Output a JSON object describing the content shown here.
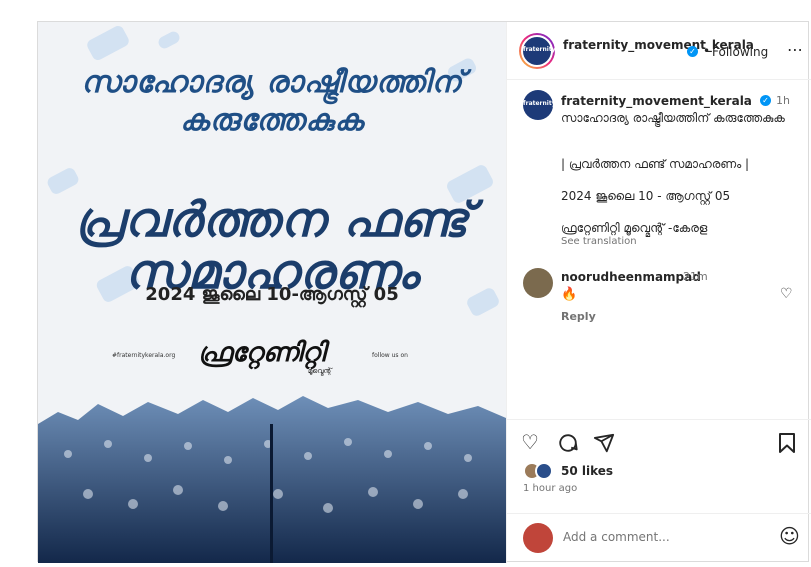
{
  "poster": {
    "headline": "സാഹോദര്യ രാഷ്ട്രീയത്തിന് കരുത്തേകുക",
    "campaign": "പ്രവർത്തന ഫണ്ട് സമാഹരണം",
    "date": "2024 ജൂലൈ 10-ആഗസ്റ്റ് 05",
    "site": "#fraternitykerala.org",
    "follow": "follow us on",
    "logo": "ഫ്രറ്റേണിറ്റി",
    "logo_sub": "മൂവ്മെന്റ്"
  },
  "header": {
    "username": "fraternity_movement_kerala",
    "follow_status": "Following",
    "avatar_text": "fraternity"
  },
  "caption": {
    "username": "fraternity_movement_kerala",
    "time": "1h",
    "line1": "സാഹോദര്യ രാഷ്ട്രീയത്തിന് കരുത്തേകുക",
    "line2": "| പ്രവർത്തന ഫണ്ട് സമാഹരണം |",
    "line3": "2024 ജൂലൈ 10 - ആഗസ്റ്റ് 05",
    "line4": "ഫ്രറ്റേണിറ്റി മൂവ്മെന്റ് -കേരള",
    "see_translation": "See translation"
  },
  "comment": {
    "username": "noorudheenmampad",
    "time": "21m",
    "text": "🔥",
    "reply": "Reply"
  },
  "engagement": {
    "likes": "50 likes",
    "posted": "1 hour ago"
  },
  "composer": {
    "placeholder": "Add a comment..."
  },
  "colors": {
    "accent": "#0095f6",
    "poster_blue": "#1f4f86"
  }
}
